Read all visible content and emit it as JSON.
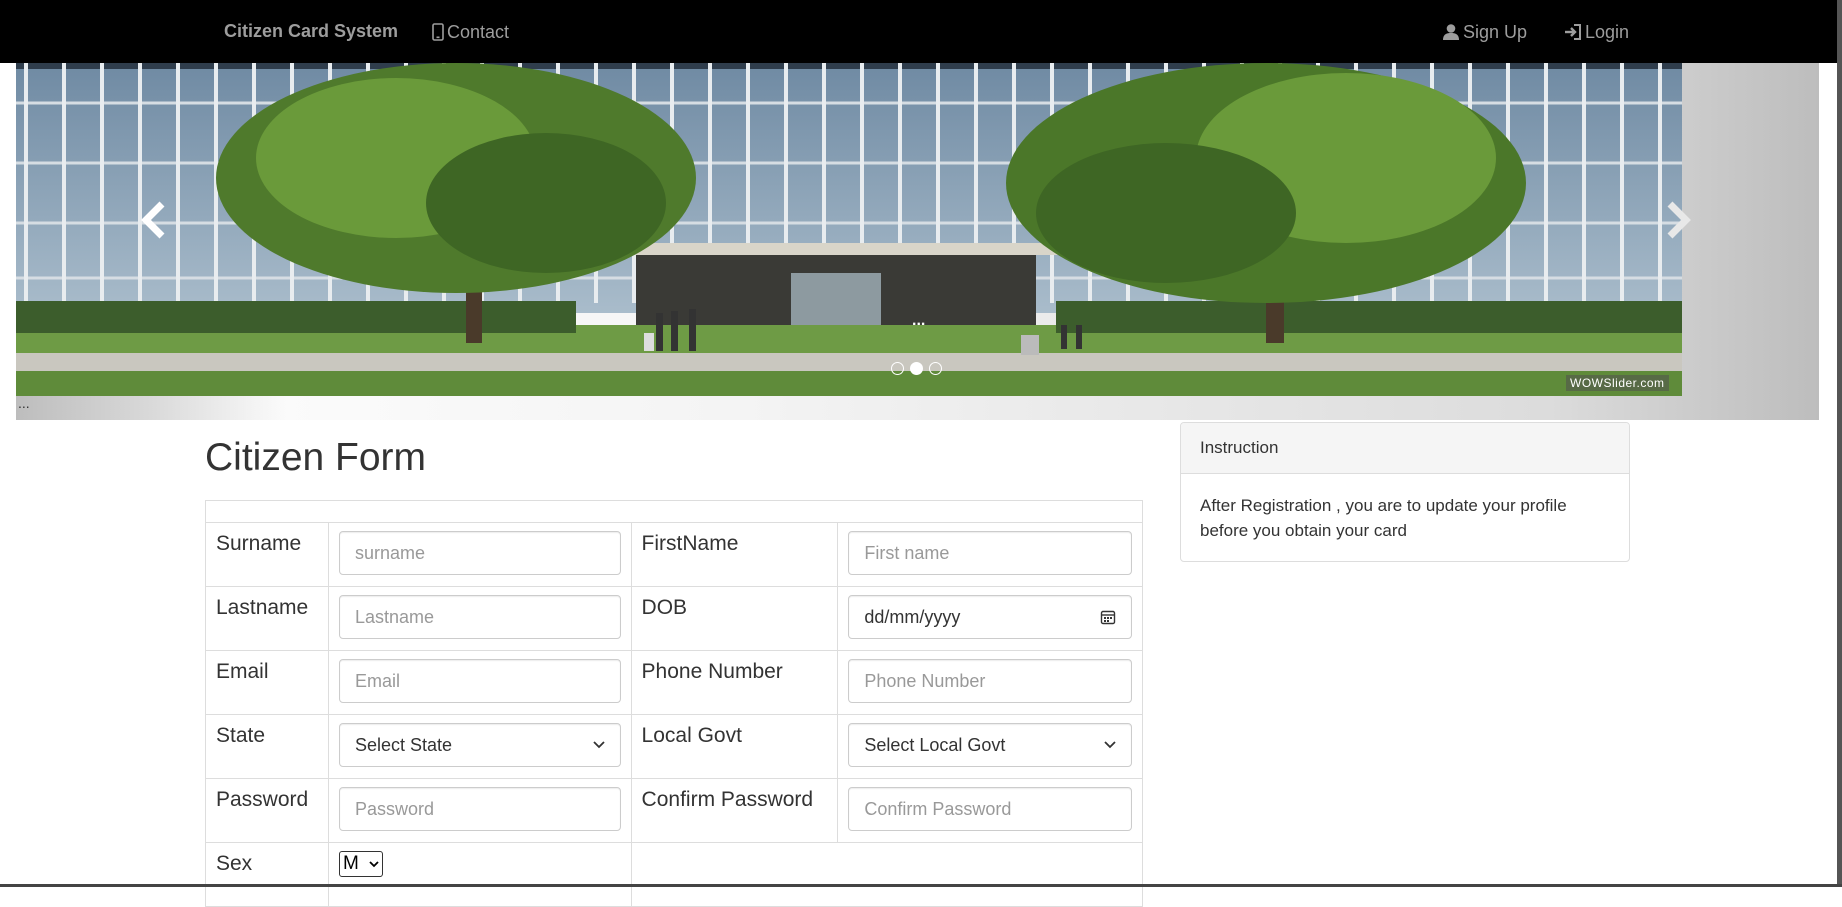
{
  "navbar": {
    "brand": "Citizen Card System",
    "contact": "Contact",
    "signup": "Sign Up",
    "login": "Login"
  },
  "slider": {
    "caption": "...",
    "bottom_caption": "...",
    "watermark": "WOWSlider.com",
    "dots": 3,
    "active_dot": 1
  },
  "form": {
    "title": "Citizen Form",
    "rows": [
      [
        {
          "label": "Surname",
          "placeholder": "surname",
          "type": "text"
        },
        {
          "label": "FirstName",
          "placeholder": "First name",
          "type": "text"
        }
      ],
      [
        {
          "label": "Lastname",
          "placeholder": "Lastname",
          "type": "text"
        },
        {
          "label": "DOB",
          "placeholder": "dd/mm/yyyy",
          "type": "date"
        }
      ],
      [
        {
          "label": "Email",
          "placeholder": "Email",
          "type": "text"
        },
        {
          "label": "Phone Number",
          "placeholder": "Phone Number",
          "type": "text"
        }
      ],
      [
        {
          "label": "State",
          "value": "Select State",
          "type": "select"
        },
        {
          "label": "Local Govt",
          "value": "Select Local Govt",
          "type": "select"
        }
      ],
      [
        {
          "label": "Password",
          "placeholder": "Password",
          "type": "text"
        },
        {
          "label": "Confirm Password",
          "placeholder": "Confirm Password",
          "type": "text"
        }
      ]
    ],
    "sex": {
      "label": "Sex",
      "value": "M"
    }
  },
  "instruction": {
    "heading": "Instruction",
    "body": "After Registration , you are to update your profile before you obtain your card"
  }
}
